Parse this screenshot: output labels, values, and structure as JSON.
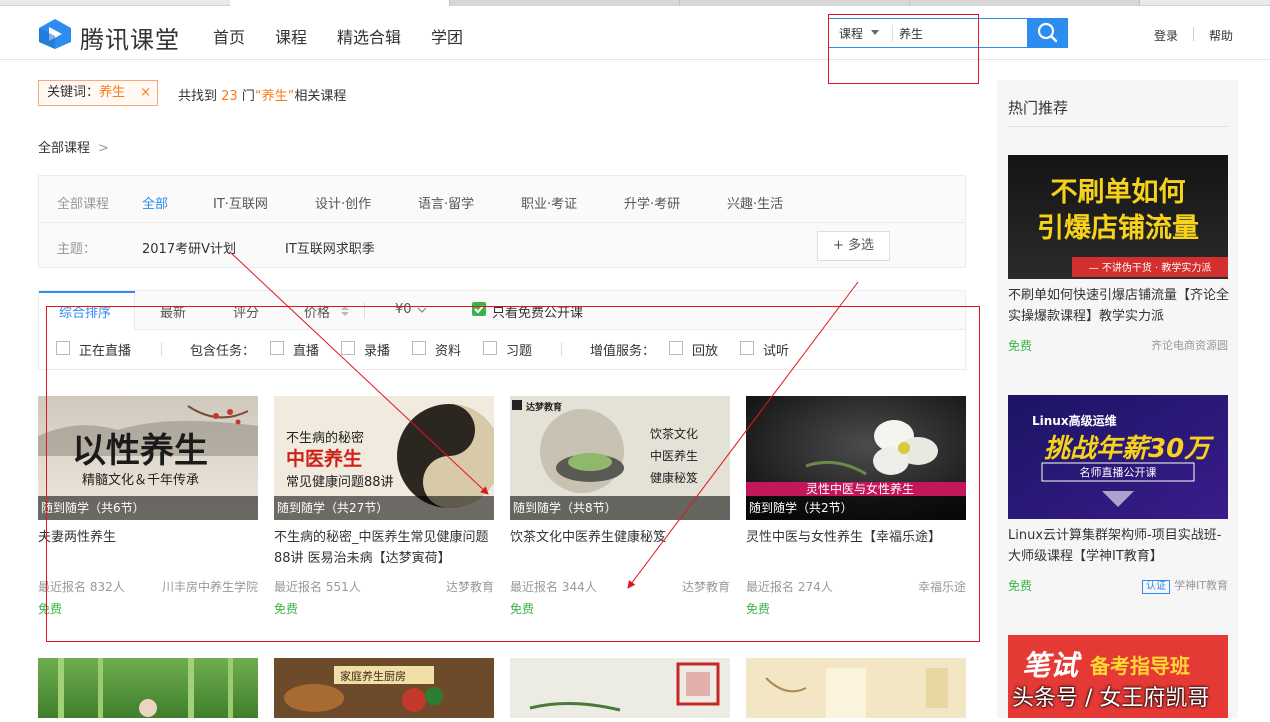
{
  "app": {
    "logo_text": "腾讯课堂",
    "nav": [
      "首页",
      "课程",
      "精选合辑",
      "学团"
    ],
    "search": {
      "type_label": "课程",
      "query": "养生"
    },
    "top_links": {
      "login": "登录",
      "help": "帮助"
    }
  },
  "result": {
    "keyword_label": "关键词：",
    "keyword": "养生",
    "keyword_close": "×",
    "found_prefix": "共找到",
    "found_count": "23",
    "found_mid": "门",
    "found_quoted": "“养生”",
    "found_suffix": "相关课程",
    "breadcrumb": "全部课程",
    "breadcrumb_arrow": ">"
  },
  "filters": {
    "category_label": "全部课程",
    "categories": [
      "全部",
      "IT·互联网",
      "设计·创作",
      "语言·留学",
      "职业·考证",
      "升学·考研",
      "兴趣·生活"
    ],
    "topic_label": "主题：",
    "topics": [
      "2017考研V计划",
      "IT互联网求职季"
    ],
    "more_button": "+ 多选"
  },
  "sort": {
    "items": [
      "综合排序",
      "最新",
      "评分",
      "价格"
    ],
    "price_filter": "¥0",
    "free_only": "只看免费公开课"
  },
  "checks": {
    "live_now": "正在直播",
    "include_label": "包含任务：",
    "include": [
      "直播",
      "录播",
      "资料",
      "习题"
    ],
    "service_label": "增值服务：",
    "services": [
      "回放",
      "试听"
    ]
  },
  "courses": [
    {
      "ribbon": "随到随学（共6节）",
      "title": "夫妻两性养生",
      "enroll": "最近报名 832人",
      "provider": "川丰房中养生学院",
      "price": "免费",
      "thumb": {
        "big": "以性养生",
        "sub": "精髓文化＆千年传承"
      }
    },
    {
      "ribbon": "随到随学（共27节）",
      "title": "不生病的秘密_中医养生常见健康问题88讲 医易治未病【达梦寅荷】",
      "enroll": "最近报名 551人",
      "provider": "达梦教育",
      "price": "免费",
      "thumb": {
        "line1": "不生病的秘密",
        "line2": "中医养生",
        "line3": "常见健康问题88讲"
      }
    },
    {
      "ribbon": "随到随学（共8节）",
      "title": "饮茶文化中医养生健康秘笈",
      "enroll": "最近报名 344人",
      "provider": "达梦教育",
      "price": "免费",
      "thumb": {
        "brand": "达梦教育",
        "line1": "饮茶文化",
        "line2": "中医养生",
        "line3": "健康秘笈"
      }
    },
    {
      "ribbon": "随到随学（共2节）",
      "title": "灵性中医与女性养生【幸福乐途】",
      "enroll": "最近报名 274人",
      "provider": "幸福乐途",
      "price": "免费",
      "thumb": {
        "caption": "灵性中医与女性养生"
      }
    }
  ],
  "row2_thumbs": {
    "second": "家庭养生厨房"
  },
  "sidebar": {
    "title": "热门推荐",
    "items": [
      {
        "title": "不刷单如何快速引爆店铺流量【齐论全实操爆款课程】教学实力派",
        "price": "免费",
        "provider": "齐论电商资源圆",
        "thumb": {
          "line1": "不刷单如何",
          "line2": "引爆店铺流量",
          "tag": "— 不讲伪干货 · 教学实力派"
        }
      },
      {
        "title": "Linux云计算集群架构师-项目实战班-大师级课程【学神IT教育】",
        "price": "免费",
        "provider": "学神IT教育",
        "badge": "认证",
        "thumb": {
          "line1": "Linux高级运维",
          "line2": "挑战年薪30万",
          "line3": "名师直播公开课"
        }
      },
      {
        "thumb": {
          "line1": "笔试",
          "line2": "备考指导班"
        }
      }
    ]
  },
  "watermark": "头条号 / 女王府凯哥",
  "colors": {
    "accent": "#2d8cf0",
    "orange": "#ff7a1a",
    "free_green": "#3cb34a",
    "annotation_red": "#e0161c"
  }
}
